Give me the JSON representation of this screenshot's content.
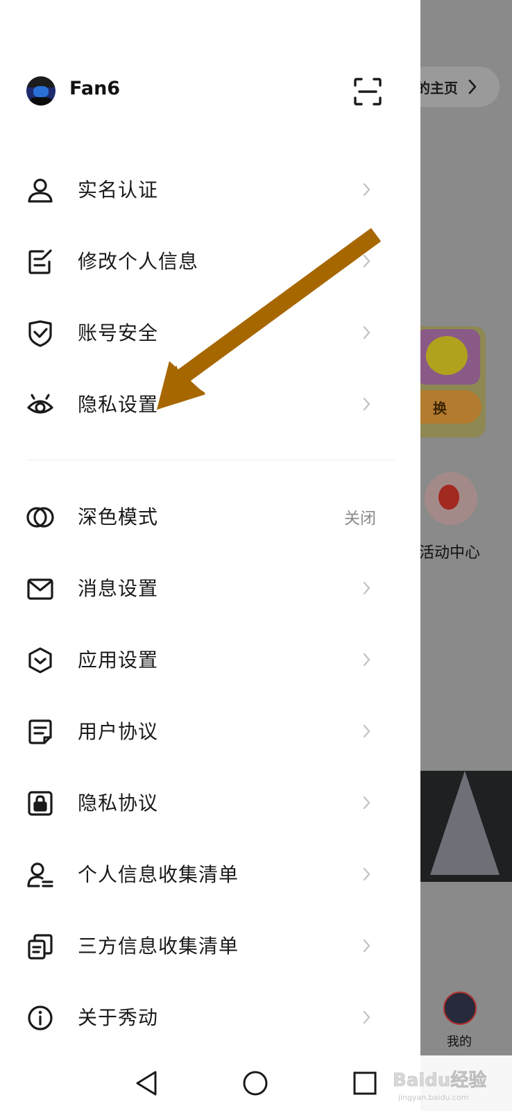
{
  "background": {
    "home_link": "的主页",
    "card_button": "换",
    "activity_label": "活动中心",
    "tab_label": "我的"
  },
  "profile": {
    "username": "Fan6"
  },
  "menu_group_1": [
    {
      "label": "实名认证",
      "icon": "person-icon"
    },
    {
      "label": "修改个人信息",
      "icon": "edit-icon"
    },
    {
      "label": "账号安全",
      "icon": "shield-check-icon"
    },
    {
      "label": "隐私设置",
      "icon": "eye-icon"
    }
  ],
  "menu_group_2": [
    {
      "label": "深色模式",
      "icon": "dark-mode-icon",
      "value": "关闭"
    },
    {
      "label": "消息设置",
      "icon": "mail-icon"
    },
    {
      "label": "应用设置",
      "icon": "hexagon-icon"
    },
    {
      "label": "用户协议",
      "icon": "document-icon"
    },
    {
      "label": "隐私协议",
      "icon": "lock-icon"
    },
    {
      "label": "个人信息收集清单",
      "icon": "person-list-icon"
    },
    {
      "label": "三方信息收集清单",
      "icon": "copy-icon"
    },
    {
      "label": "关于秀动",
      "icon": "info-icon"
    }
  ],
  "watermark": {
    "text": "Baidu经验",
    "subtext": "jingyan.baidu.com"
  },
  "colors": {
    "annotation_arrow": "#a76700",
    "dim_overlay": "#8a8a8a"
  }
}
